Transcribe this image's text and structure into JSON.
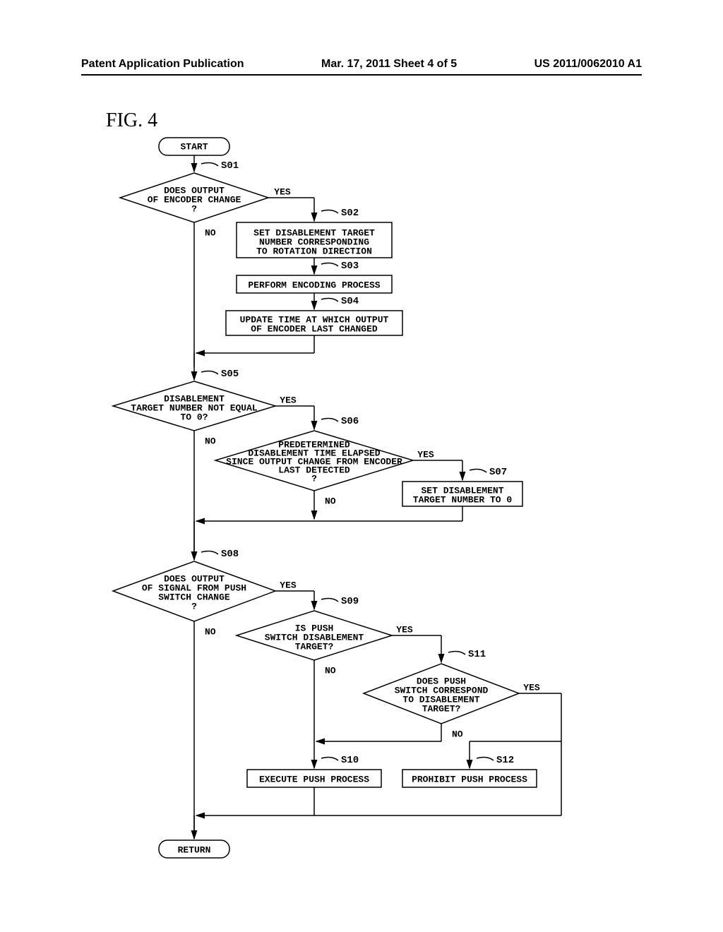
{
  "header": {
    "left": "Patent Application Publication",
    "center": "Mar. 17, 2011  Sheet 4 of 5",
    "right": "US 2011/0062010 A1"
  },
  "figure_label": "FIG. 4",
  "chart_data": {
    "type": "flowchart",
    "nodes": [
      {
        "id": "start",
        "type": "terminal",
        "label": "START"
      },
      {
        "id": "S01",
        "type": "decision",
        "step": "S01",
        "label": "DOES OUTPUT OF ENCODER CHANGE ?"
      },
      {
        "id": "S02",
        "type": "process",
        "step": "S02",
        "label": "SET DISABLEMENT TARGET NUMBER CORRESPONDING TO ROTATION DIRECTION"
      },
      {
        "id": "S03",
        "type": "process",
        "step": "S03",
        "label": "PERFORM ENCODING PROCESS"
      },
      {
        "id": "S04",
        "type": "process",
        "step": "S04",
        "label": "UPDATE TIME AT WHICH OUTPUT OF ENCODER LAST CHANGED"
      },
      {
        "id": "S05",
        "type": "decision",
        "step": "S05",
        "label": "DISABLEMENT TARGET NUMBER NOT EQUAL TO 0?"
      },
      {
        "id": "S06",
        "type": "decision",
        "step": "S06",
        "label": "PREDETERMINED DISABLEMENT TIME ELAPSED SINCE OUTPUT CHANGE FROM ENCODER LAST DETECTED ?"
      },
      {
        "id": "S07",
        "type": "process",
        "step": "S07",
        "label": "SET DISABLEMENT TARGET NUMBER TO 0"
      },
      {
        "id": "S08",
        "type": "decision",
        "step": "S08",
        "label": "DOES OUTPUT OF SIGNAL FROM PUSH SWITCH CHANGE ?"
      },
      {
        "id": "S09",
        "type": "decision",
        "step": "S09",
        "label": "IS PUSH SWITCH DISABLEMENT TARGET?"
      },
      {
        "id": "S10",
        "type": "process",
        "step": "S10",
        "label": "EXECUTE PUSH PROCESS"
      },
      {
        "id": "S11",
        "type": "decision",
        "step": "S11",
        "label": "DOES PUSH SWITCH CORRESPOND TO DISABLEMENT TARGET?"
      },
      {
        "id": "S12",
        "type": "process",
        "step": "S12",
        "label": "PROHIBIT PUSH PROCESS"
      },
      {
        "id": "return",
        "type": "terminal",
        "label": "RETURN"
      }
    ],
    "edges": [
      {
        "from": "start",
        "to": "S01"
      },
      {
        "from": "S01",
        "to": "S02",
        "label": "YES"
      },
      {
        "from": "S01",
        "to": "S05",
        "label": "NO"
      },
      {
        "from": "S02",
        "to": "S03"
      },
      {
        "from": "S03",
        "to": "S04"
      },
      {
        "from": "S04",
        "to": "S05"
      },
      {
        "from": "S05",
        "to": "S06",
        "label": "YES"
      },
      {
        "from": "S05",
        "to": "S08",
        "label": "NO"
      },
      {
        "from": "S06",
        "to": "S07",
        "label": "YES"
      },
      {
        "from": "S06",
        "to": "S08",
        "label": "NO"
      },
      {
        "from": "S07",
        "to": "S08"
      },
      {
        "from": "S08",
        "to": "S09",
        "label": "YES"
      },
      {
        "from": "S08",
        "to": "return",
        "label": "NO"
      },
      {
        "from": "S09",
        "to": "S11",
        "label": "YES"
      },
      {
        "from": "S09",
        "to": "S10",
        "label": "NO"
      },
      {
        "from": "S10",
        "to": "return"
      },
      {
        "from": "S11",
        "to": "return",
        "label": "YES"
      },
      {
        "from": "S11",
        "to": "S12",
        "label": "NO"
      },
      {
        "from": "S12",
        "to": "return"
      }
    ]
  },
  "labels": {
    "yes": "YES",
    "no": "NO"
  }
}
